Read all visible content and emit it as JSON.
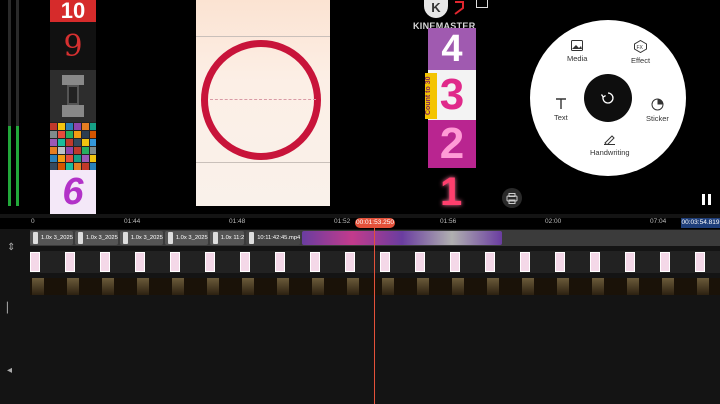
{
  "app": {
    "brand": "KINEMASTER",
    "logo_letter": "K"
  },
  "left_thumbs": {
    "t1_text": "10",
    "t2_text": "9",
    "t5_text": "6"
  },
  "right_strip": {
    "n4": "4",
    "n3": "3",
    "count_label": "Count to 30",
    "n2": "2",
    "n1": "1"
  },
  "menu": {
    "media": "Media",
    "effect": "Effect",
    "text": "Text",
    "sticker": "Sticker",
    "handwriting": "Handwriting"
  },
  "timeline": {
    "ticks": [
      "0",
      "01:44",
      "01:48",
      "01:52",
      "01:56",
      "02:00",
      "07:04"
    ],
    "playhead_time": "00:01:53.250",
    "end_time": "00:03:54.819",
    "clip_labels": [
      "1.0x",
      "1.0x",
      "1.0x",
      "1.0x",
      "1.0x"
    ],
    "clip_names": [
      "3_2025",
      "3_2025",
      "3_2025",
      "3_2025",
      "11:2",
      "10:11:42:45.mp4"
    ]
  },
  "colors": {
    "accent": "#e4513a",
    "meter": "#22a83a",
    "ring": "#c8143a"
  }
}
